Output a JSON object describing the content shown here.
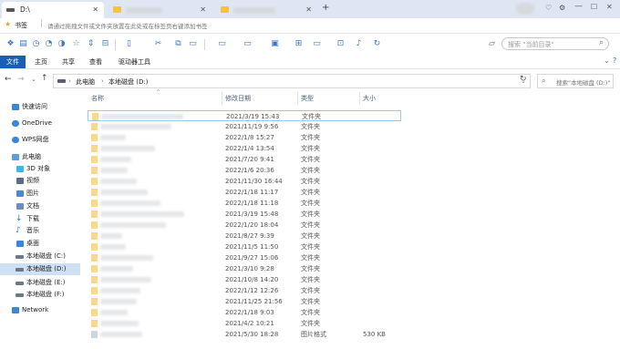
{
  "tabs": [
    {
      "label": "D:\\",
      "active": true
    },
    {
      "label": "",
      "active": false
    },
    {
      "label": "",
      "active": false
    }
  ],
  "new_tab": "+",
  "bookmarks": {
    "label": "书签",
    "hint": "请通过拖拽文件或文件夹放置在此处或在标签页右键添加书签"
  },
  "toolbar_search_placeholder": "搜索 \"当前目录\"",
  "ribbon_tabs": [
    "文件",
    "主页",
    "共享",
    "查看",
    "驱动器工具"
  ],
  "breadcrumb": [
    "此电脑",
    "本地磁盘 (D:)"
  ],
  "address_search_placeholder": "搜索\"本地磁盘 (D:)\"",
  "nav": [
    {
      "label": "快速访问",
      "icon": "star-icon",
      "color": "#3a86d8"
    },
    {
      "label": "OneDrive",
      "icon": "cloud-icon",
      "color": "#3a86d8"
    },
    {
      "label": "WPS网盘",
      "icon": "cloud-icon",
      "color": "#3a86d8"
    },
    {
      "label": "此电脑",
      "icon": "computer-icon",
      "color": "#5aa0e0"
    },
    {
      "label": "3D 对象",
      "icon": "cube-icon",
      "color": "#3fb6e8"
    },
    {
      "label": "视频",
      "icon": "video-icon",
      "color": "#5a6b8c"
    },
    {
      "label": "图片",
      "icon": "picture-icon",
      "color": "#4a8ad0"
    },
    {
      "label": "文档",
      "icon": "document-icon",
      "color": "#6a8fc0"
    },
    {
      "label": "下载",
      "icon": "download-icon",
      "color": "#2d7bd6"
    },
    {
      "label": "音乐",
      "icon": "music-icon",
      "color": "#2d7bd6"
    },
    {
      "label": "桌面",
      "icon": "desktop-icon",
      "color": "#3a86d8"
    },
    {
      "label": "本地磁盘 (C:)",
      "icon": "drive-icon",
      "color": "#6a7a8a"
    },
    {
      "label": "本地磁盘 (D:)",
      "icon": "drive-icon",
      "color": "#6a7a8a",
      "selected": true
    },
    {
      "label": "本地磁盘 (E:)",
      "icon": "drive-icon",
      "color": "#6a7a8a"
    },
    {
      "label": "本地磁盘 (F:)",
      "icon": "drive-icon",
      "color": "#6a7a8a"
    },
    {
      "label": "Network",
      "icon": "network-icon",
      "color": "#3a86d8"
    }
  ],
  "columns": {
    "name": "名称",
    "date": "修改日期",
    "type": "类型",
    "size": "大小"
  },
  "files": [
    {
      "date": "2021/3/19 15:43",
      "type": "文件夹",
      "size": ""
    },
    {
      "date": "2021/11/19 9:56",
      "type": "文件夹",
      "size": ""
    },
    {
      "date": "2022/1/8 15:27",
      "type": "文件夹",
      "size": ""
    },
    {
      "date": "2022/1/4 13:54",
      "type": "文件夹",
      "size": ""
    },
    {
      "date": "2021/7/20 9:41",
      "type": "文件夹",
      "size": ""
    },
    {
      "date": "2022/1/6 20:36",
      "type": "文件夹",
      "size": ""
    },
    {
      "date": "2021/11/30 16:44",
      "type": "文件夹",
      "size": ""
    },
    {
      "date": "2022/1/18 11:17",
      "type": "文件夹",
      "size": ""
    },
    {
      "date": "2022/1/18 11:18",
      "type": "文件夹",
      "size": ""
    },
    {
      "date": "2021/3/19 15:48",
      "type": "文件夹",
      "size": ""
    },
    {
      "date": "2022/1/20 18:04",
      "type": "文件夹",
      "size": ""
    },
    {
      "date": "2021/8/27 9:39",
      "type": "文件夹",
      "size": ""
    },
    {
      "date": "2021/11/5 11:50",
      "type": "文件夹",
      "size": ""
    },
    {
      "date": "2021/9/27 15:06",
      "type": "文件夹",
      "size": ""
    },
    {
      "date": "2021/3/10 9:28",
      "type": "文件夹",
      "size": ""
    },
    {
      "date": "2021/10/8 14:20",
      "type": "文件夹",
      "size": ""
    },
    {
      "date": "2022/1/12 12:26",
      "type": "文件夹",
      "size": ""
    },
    {
      "date": "2021/11/25 21:56",
      "type": "文件夹",
      "size": ""
    },
    {
      "date": "2022/1/18 9:03",
      "type": "文件夹",
      "size": ""
    },
    {
      "date": "2021/4/2 10:21",
      "type": "文件夹",
      "size": ""
    },
    {
      "date": "2021/5/30 18:28",
      "type": "图片格式",
      "size": "530 KB"
    }
  ]
}
